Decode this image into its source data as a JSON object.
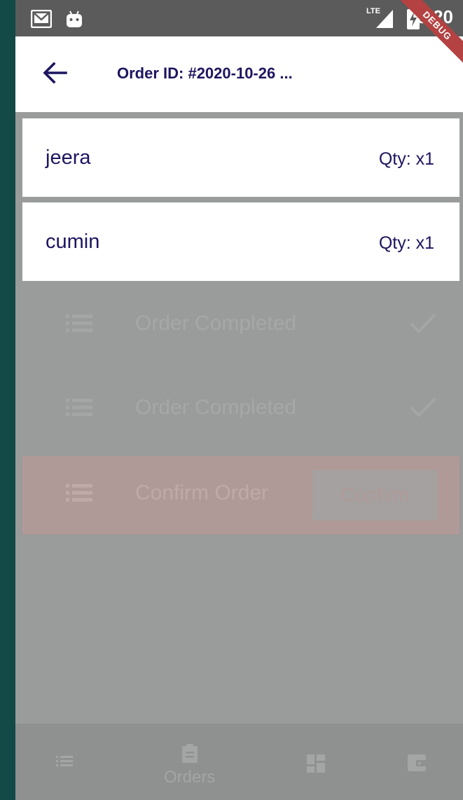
{
  "status_bar": {
    "time": "8:20",
    "network": "LTE",
    "debug_banner": "DEBUG"
  },
  "app_bar": {
    "title": "Order ID: #2020-10-26 ..."
  },
  "items": [
    {
      "name": "jeera",
      "qty": "Qty: x1"
    },
    {
      "name": "cumin",
      "qty": "Qty: x1"
    }
  ],
  "background": {
    "rows": [
      {
        "label": "Order Completed"
      },
      {
        "label": "Order Completed"
      }
    ],
    "confirm_row": {
      "label": "Confirm Order",
      "button": "Confirm"
    }
  },
  "bottom_nav": {
    "orders_label": "Orders"
  },
  "colors": {
    "primary": "#1d1660",
    "scrim": "#9a9b9b",
    "debug": "#b44242"
  }
}
